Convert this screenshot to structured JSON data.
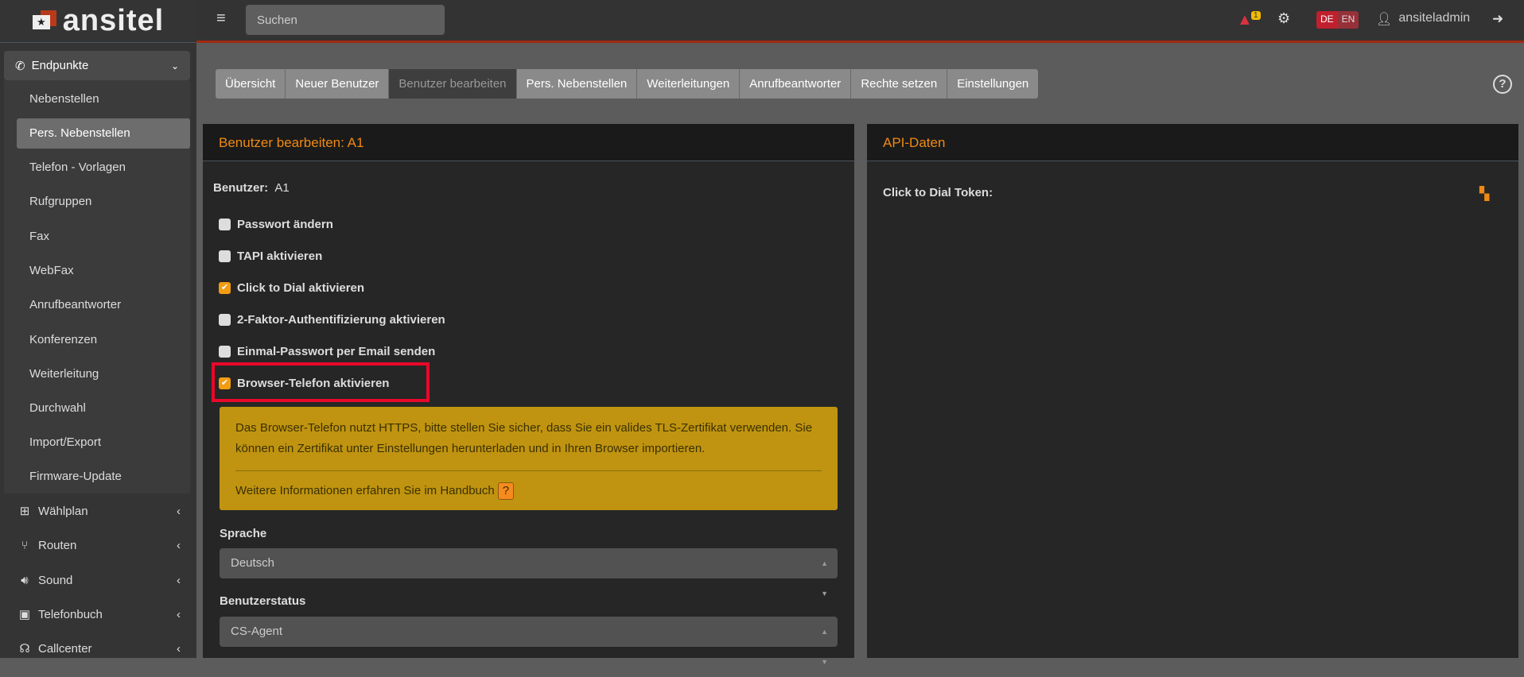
{
  "brand": {
    "name": "ansitel"
  },
  "header": {
    "search_placeholder": "Suchen",
    "alert_count": "1",
    "lang": [
      "DE",
      "EN"
    ],
    "username": "ansiteladmin"
  },
  "sidebar": {
    "group": "Endpunkte",
    "items": [
      "Nebenstellen",
      "Pers. Nebenstellen",
      "Telefon - Vorlagen",
      "Rufgruppen",
      "Fax",
      "WebFax",
      "Anrufbeantworter",
      "Konferenzen",
      "Weiterleitung",
      "Durchwahl",
      "Import/Export",
      "Firmware-Update"
    ],
    "active_item": "Pers. Nebenstellen",
    "top": [
      "Wählplan",
      "Routen",
      "Sound",
      "Telefonbuch",
      "Callcenter"
    ]
  },
  "tabs": [
    "Übersicht",
    "Neuer Benutzer",
    "Benutzer bearbeiten",
    "Pers. Nebenstellen",
    "Weiterleitungen",
    "Anrufbeantworter",
    "Rechte setzen",
    "Einstellungen"
  ],
  "active_tab": "Benutzer bearbeiten",
  "edit": {
    "title": "Benutzer bearbeiten: A1",
    "user_label": "Benutzer:",
    "user_value": "A1",
    "checkboxes": [
      {
        "label": "Passwort ändern",
        "checked": false
      },
      {
        "label": "TAPI aktivieren",
        "checked": false
      },
      {
        "label": "Click to Dial aktivieren",
        "checked": true
      },
      {
        "label": "2-Faktor-Authentifizierung aktivieren",
        "checked": false
      },
      {
        "label": "Einmal-Passwort per Email senden",
        "checked": false
      },
      {
        "label": "Browser-Telefon aktivieren",
        "checked": true
      }
    ],
    "warning": "Das Browser-Telefon nutzt HTTPS, bitte stellen Sie sicher, dass Sie ein valides TLS-Zertifikat verwenden. Sie können ein Zertifikat unter Einstellungen herunterladen und in Ihren Browser importieren.",
    "warning_more": "Weitere Informationen erfahren Sie im Handbuch",
    "language_label": "Sprache",
    "language_value": "Deutsch",
    "status_label": "Benutzerstatus",
    "status_value": "CS-Agent"
  },
  "api": {
    "title": "API-Daten",
    "token_label": "Click to Dial Token:"
  },
  "colors": {
    "accent": "#f08a13",
    "highlight": "#e8082a",
    "warning_bg": "#c09410"
  }
}
